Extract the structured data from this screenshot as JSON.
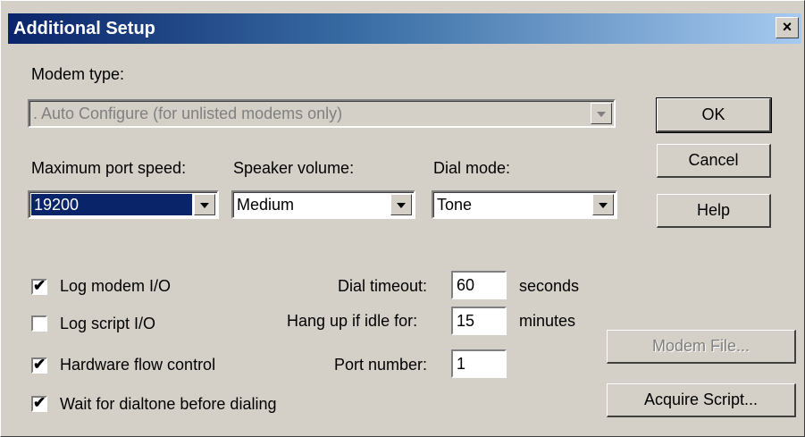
{
  "window": {
    "title": "Additional Setup",
    "close_glyph": "×"
  },
  "modem_type": {
    "label": "Modem type:",
    "value": ". Auto Configure (for unlisted modems only)"
  },
  "port_speed": {
    "label": "Maximum port speed:",
    "value": "19200"
  },
  "speaker_volume": {
    "label": "Speaker volume:",
    "value": "Medium"
  },
  "dial_mode": {
    "label": "Dial mode:",
    "value": "Tone"
  },
  "buttons": {
    "ok": "OK",
    "cancel": "Cancel",
    "help": "Help",
    "modem_file": "Modem File...",
    "acquire_script": "Acquire Script..."
  },
  "checkboxes": {
    "log_modem": {
      "label": "Log modem I/O",
      "checked": true
    },
    "log_script": {
      "label": "Log script I/O",
      "checked": false
    },
    "hw_flow": {
      "label": "Hardware flow control",
      "checked": true
    },
    "wait_dialtone": {
      "label": "Wait for dialtone before dialing",
      "checked": true
    }
  },
  "dial_timeout": {
    "label": "Dial timeout:",
    "value": "60",
    "unit": "seconds"
  },
  "hang_up": {
    "label": "Hang up if idle for:",
    "value": "15",
    "unit": "minutes"
  },
  "port_number": {
    "label": "Port number:",
    "value": "1"
  },
  "check_glyph": "✔"
}
